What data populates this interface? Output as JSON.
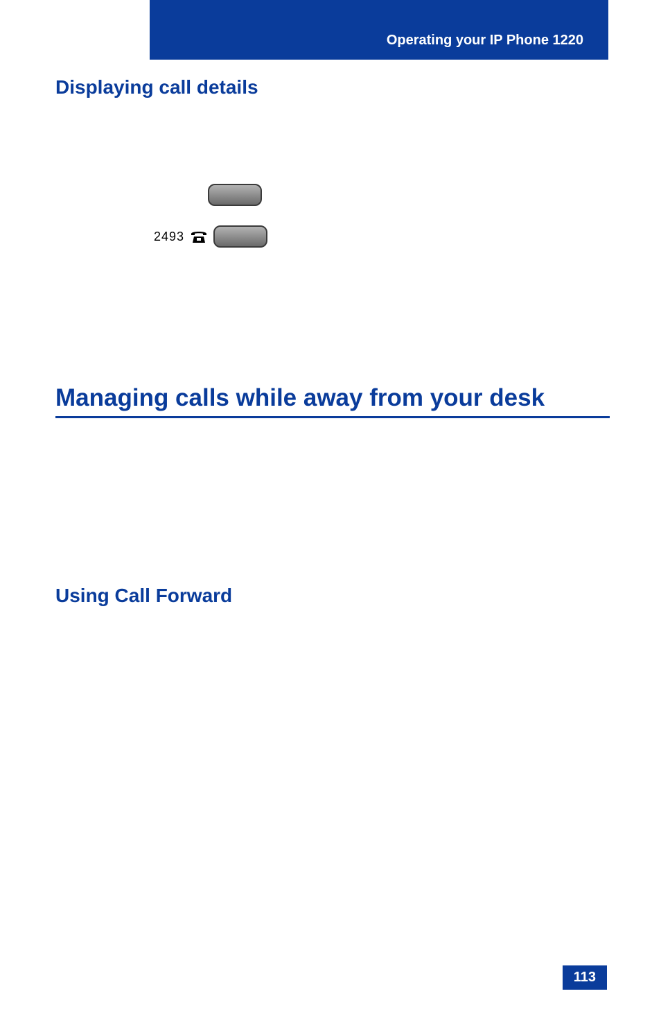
{
  "header": {
    "title": "Operating your IP Phone 1220"
  },
  "sections": {
    "displaying": "Displaying call details",
    "managing": "Managing calls while away from your desk",
    "using": "Using Call Forward"
  },
  "keys": {
    "extension": "2493"
  },
  "page": {
    "number": "113"
  }
}
